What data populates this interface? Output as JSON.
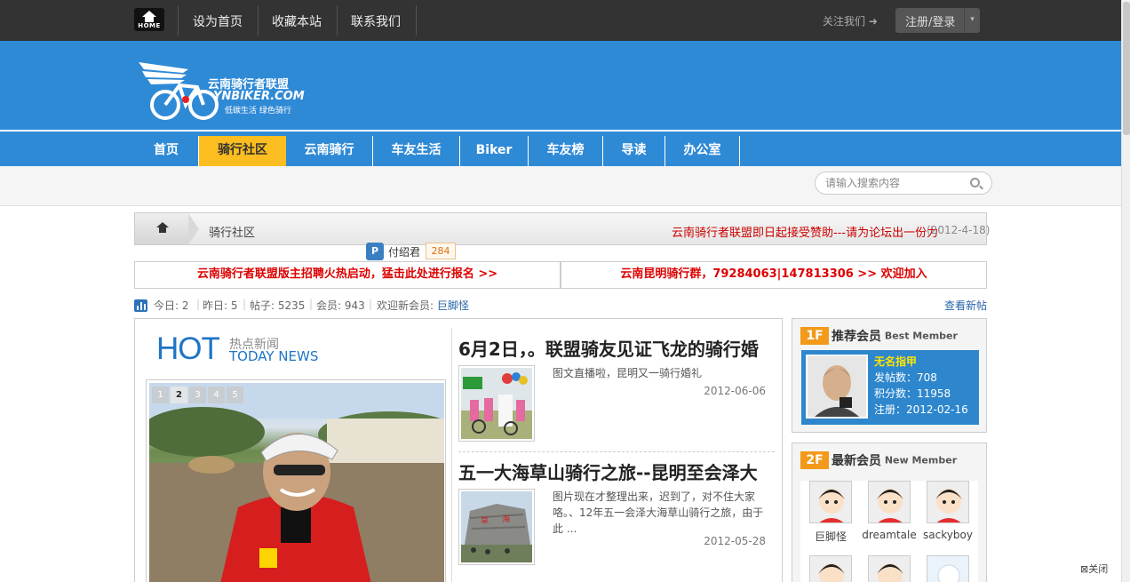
{
  "topbar": {
    "home_label": "HOME",
    "links": [
      "设为首页",
      "收藏本站",
      "联系我们"
    ],
    "follow": "关注我们 ➜",
    "login": "注册/登录"
  },
  "logo": {
    "cn": "云南骑行者联盟",
    "en": "YNBIKER.COM",
    "slogan": "低碳生活 绿色骑行"
  },
  "nav": {
    "items": [
      "首页",
      "骑行社区",
      "云南骑行",
      "车友生活",
      "Biker",
      "车友榜",
      "导读",
      "办公室"
    ],
    "active": "骑行社区"
  },
  "search": {
    "placeholder": "请输入搜索内容"
  },
  "breadcrumb": {
    "current": "骑行社区",
    "notice": "云南骑行者联盟即日起接受赞助---请为论坛出一份力",
    "notice_date": "(2012-4-18)"
  },
  "user_popup": {
    "name": "付绍君",
    "count": "284"
  },
  "ads": [
    "云南骑行者联盟版主招聘火热启动，猛击此处进行报名 >>",
    "云南昆明骑行群，79284063|147813306 >> 欢迎加入"
  ],
  "stats": {
    "today_label": "今日:",
    "today": "2",
    "yesterday_label": "昨日:",
    "yesterday": "5",
    "posts_label": "帖子:",
    "posts": "5235",
    "members_label": "会员:",
    "members": "943",
    "welcome_label": "欢迎新会员:",
    "new_member": "巨脚怪",
    "view_new": "查看新帖"
  },
  "hot": {
    "big": "HOT",
    "cn": "热点新闻",
    "en": "TODAY NEWS"
  },
  "slider": {
    "pages": [
      "1",
      "2",
      "3",
      "4",
      "5"
    ],
    "current": "2"
  },
  "articles": [
    {
      "title": "6月2日，。联盟骑友见证飞龙的骑行婚",
      "summary": "图文直播啦，昆明又一骑行婚礼",
      "date": "2012-06-06"
    },
    {
      "title": "五一大海草山骑行之旅--昆明至会泽大",
      "summary": "图片现在才整理出来，迟到了，对不住大家咯。、12年五一会泽大海草山骑行之旅，由于此 ...",
      "date": "2012-05-28"
    }
  ],
  "best_member": {
    "floor": "1F",
    "title_cn": "推荐会员",
    "title_en": "Best Member",
    "name": "无名指甲",
    "posts": "发帖数：708",
    "points": "积分数：11958",
    "registered": "注册：2012-02-16"
  },
  "new_members": {
    "floor": "2F",
    "title_cn": "最新会员",
    "title_en": "New Member",
    "names": [
      "巨脚怪",
      "dreamtale",
      "sackyboy"
    ]
  },
  "close": "关闭"
}
